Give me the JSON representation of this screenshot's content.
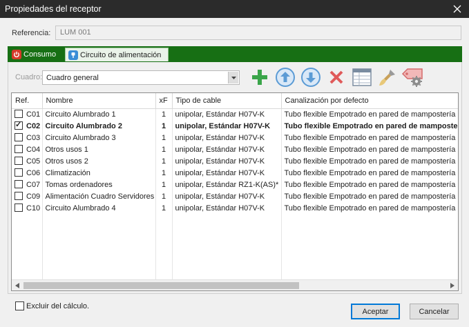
{
  "window": {
    "title": "Propiedades del receptor"
  },
  "referencia": {
    "label": "Referencia:",
    "value": "LUM 001"
  },
  "tabs": [
    {
      "label": "Consumo",
      "icon": "power-icon"
    },
    {
      "label": "Circuito de alimentación",
      "icon": "plug-icon"
    }
  ],
  "cuadro": {
    "label": "Cuadro:",
    "value": "Cuadro general"
  },
  "toolbar": [
    "add-icon",
    "move-up-icon",
    "move-down-icon",
    "delete-icon",
    "table-icon",
    "brush-icon",
    "tag-settings-icon"
  ],
  "grid": {
    "columns": [
      "Ref.",
      "Nombre",
      "xF",
      "Tipo de cable",
      "Canalización por defecto"
    ],
    "rows": [
      {
        "ref": "C01",
        "checked": false,
        "nombre": "Circuito Alumbrado 1",
        "xf": "1",
        "cable": "unipolar, Estándar H07V-K",
        "canal": "Tubo flexible Empotrado en pared de mampostería"
      },
      {
        "ref": "C02",
        "checked": true,
        "nombre": "Circuito Alumbrado 2",
        "xf": "1",
        "cable": "unipolar, Estándar H07V-K",
        "canal": "Tubo flexible Empotrado en pared de mamposte"
      },
      {
        "ref": "C03",
        "checked": false,
        "nombre": "Circuito Alumbrado 3",
        "xf": "1",
        "cable": "unipolar, Estándar H07V-K",
        "canal": "Tubo flexible Empotrado en pared de mampostería"
      },
      {
        "ref": "C04",
        "checked": false,
        "nombre": "Otros usos 1",
        "xf": "1",
        "cable": "unipolar, Estándar H07V-K",
        "canal": "Tubo flexible Empotrado en pared de mampostería"
      },
      {
        "ref": "C05",
        "checked": false,
        "nombre": "Otros usos 2",
        "xf": "1",
        "cable": "unipolar, Estándar H07V-K",
        "canal": "Tubo flexible Empotrado en pared de mampostería"
      },
      {
        "ref": "C06",
        "checked": false,
        "nombre": "Climatización",
        "xf": "1",
        "cable": "unipolar, Estándar H07V-K",
        "canal": "Tubo flexible Empotrado en pared de mampostería"
      },
      {
        "ref": "C07",
        "checked": false,
        "nombre": "Tomas ordenadores",
        "xf": "1",
        "cable": "unipolar, Estándar RZ1-K(AS)*",
        "canal": "Tubo flexible Empotrado en pared de mampostería"
      },
      {
        "ref": "C09",
        "checked": false,
        "nombre": "Alimentación Cuadro Servidores",
        "xf": "1",
        "cable": "unipolar, Estándar H07V-K",
        "canal": "Tubo flexible Empotrado en pared de mampostería"
      },
      {
        "ref": "C10",
        "checked": false,
        "nombre": "Circuito Alumbrado 4",
        "xf": "1",
        "cable": "unipolar, Estándar H07V-K",
        "canal": "Tubo flexible Empotrado en pared de mampostería"
      }
    ]
  },
  "excluir": {
    "label": "Excluir del cálculo.",
    "checked": false
  },
  "buttons": {
    "aceptar": "Aceptar",
    "cancelar": "Cancelar"
  },
  "colors": {
    "tabbar": "#176f14",
    "add": "#3aa54a",
    "arrows": "#5b9bd5",
    "delete": "#e05a5a",
    "focus": "#0078d7"
  }
}
